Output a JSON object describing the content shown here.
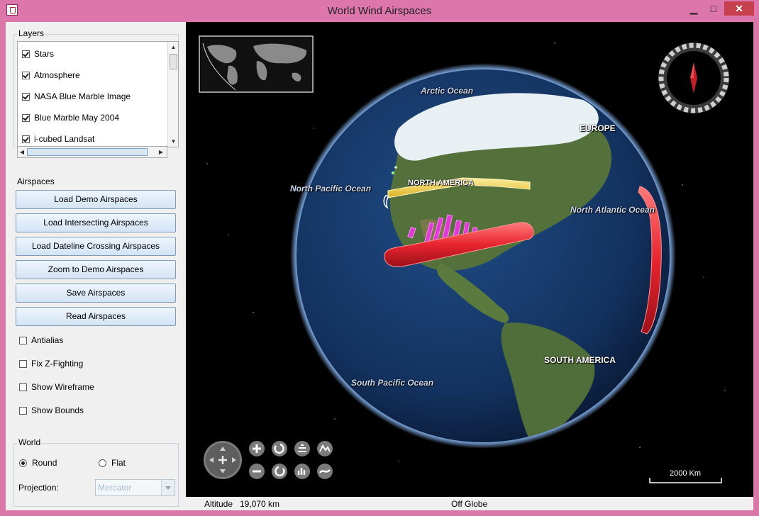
{
  "window": {
    "title": "World Wind Airspaces",
    "minimize": "▁",
    "maximize": "□",
    "close": "✕"
  },
  "layers": {
    "title": "Layers",
    "items": [
      {
        "label": "Stars",
        "checked": true
      },
      {
        "label": "Atmosphere",
        "checked": true
      },
      {
        "label": "NASA Blue Marble Image",
        "checked": true
      },
      {
        "label": "Blue Marble May 2004",
        "checked": true
      },
      {
        "label": "i-cubed Landsat",
        "checked": true
      }
    ]
  },
  "airspaces": {
    "title": "Airspaces",
    "buttons": [
      "Load Demo Airspaces",
      "Load Intersecting Airspaces",
      "Load Dateline Crossing Airspaces",
      "Zoom to Demo Airspaces",
      "Save Airspaces",
      "Read Airspaces"
    ],
    "options": [
      {
        "label": "Antialias",
        "checked": false
      },
      {
        "label": "Fix Z-Fighting",
        "checked": false
      },
      {
        "label": "Show Wireframe",
        "checked": false
      },
      {
        "label": "Show Bounds",
        "checked": false
      }
    ]
  },
  "world": {
    "title": "World",
    "round_label": "Round",
    "flat_label": "Flat",
    "selected": "Round",
    "projection_label": "Projection:",
    "projection_value": "Mercator"
  },
  "globe": {
    "labels": {
      "arctic": "Arctic Ocean",
      "europe": "EUROPE",
      "north_pacific": "North Pacific Ocean",
      "north_america": "NORTH AMERICA",
      "north_atlantic": "North Atlantic Ocean",
      "south_america": "SOUTH AMERICA",
      "south_pacific": "South Pacific Ocean"
    },
    "scale_label": "2000 Km",
    "colors": {
      "ocean": "#13315e",
      "land": "#4f6e3a",
      "ice": "#eef3f6",
      "airspace_red": "#e8252f",
      "airspace_yellow": "#f0d53a",
      "airspace_magenta": "#e23ad6"
    }
  },
  "status": {
    "altitude_label": "Altitude",
    "altitude_value": "19,070 km",
    "position": "Off Globe"
  }
}
